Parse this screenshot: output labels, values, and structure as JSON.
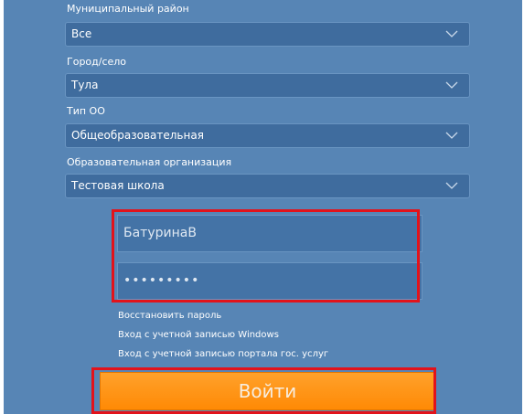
{
  "form": {
    "district": {
      "label": "Муниципальный район",
      "value": "Все"
    },
    "city": {
      "label": "Город/село",
      "value": "Тула"
    },
    "org_type": {
      "label": "Тип ОО",
      "value": "Общеобразовательная"
    },
    "org": {
      "label": "Образовательная организация",
      "value": "Тестовая школа"
    },
    "username": "БатуринаВ",
    "password_mask": "•••••••••"
  },
  "links": {
    "restore": "Восстановить пароль",
    "windows": "Вход с учетной записью Windows",
    "gosuslugi": "Вход с учетной записью портала гос. услуг"
  },
  "login_button": "Войти",
  "colors": {
    "panel": "#5785b5",
    "highlight": "#e2131b",
    "button": "#ff9010"
  }
}
